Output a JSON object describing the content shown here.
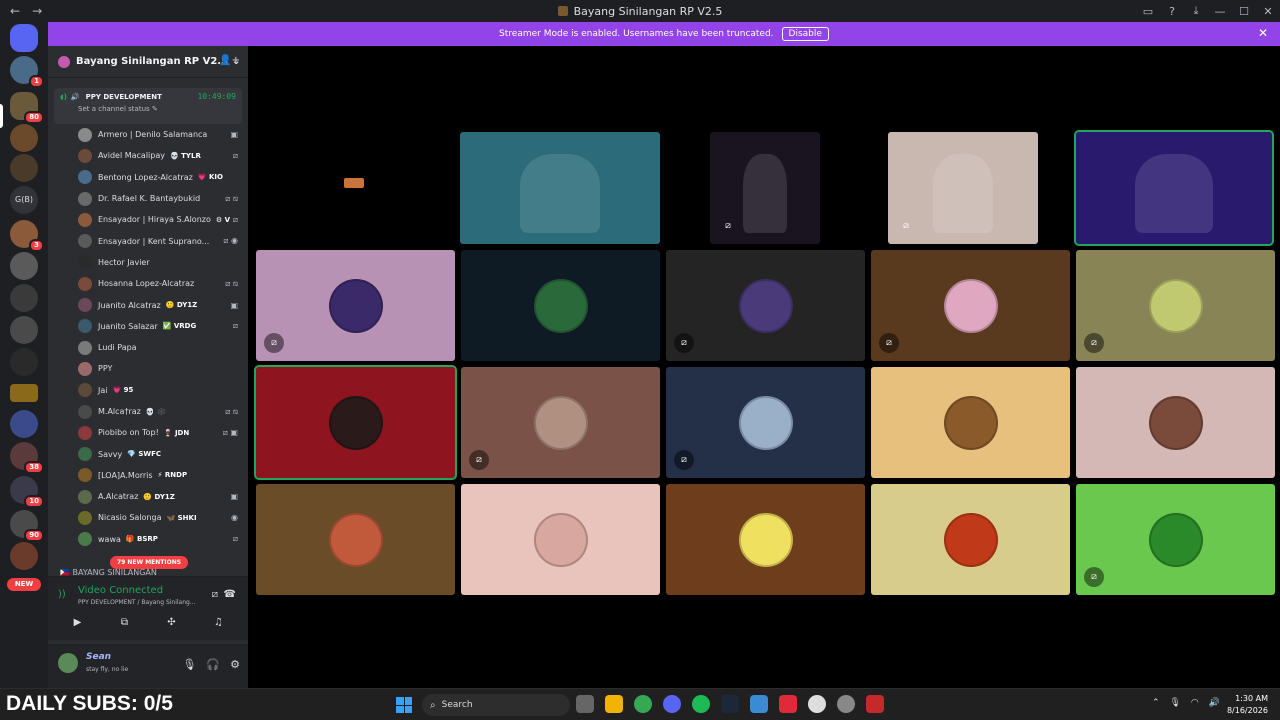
{
  "window": {
    "title": "Bayang Sinilangan RP V2.5",
    "back": "←",
    "forward": "→"
  },
  "banner": {
    "text": "Streamer Mode is enabled. Usernames have been truncated.",
    "button": "Disable",
    "close": "✕"
  },
  "servers": {
    "home_icon": "discord-icon",
    "badges": [
      "1",
      "80",
      "3",
      "38",
      "10",
      "90"
    ],
    "guild_initials": "G(B)",
    "new_label": "NEW"
  },
  "guild": {
    "name": "Bayang Sinilangan RP V2.5",
    "chevron": "⌄",
    "invite": "👤+"
  },
  "voice_channel": {
    "name": "PPY DEVELOPMENT",
    "time": "10:49:09",
    "status": "Set a channel status ✎"
  },
  "members": [
    {
      "name": "Armero | Denilo Salamanca",
      "tag": "",
      "icon": "▣"
    },
    {
      "name": "Avidel Macalipay",
      "tag": "💀 TYLR",
      "icon": "⧄"
    },
    {
      "name": "Bentong Lopez-Alcatraz",
      "tag": "💗 KIO",
      "icon": ""
    },
    {
      "name": "Dr. Rafael K. Bantaybukid",
      "tag": "",
      "icon": "⧄ ⧅"
    },
    {
      "name": "Ensayador | Hiraya S.Alonzo",
      "tag": "⚙ V",
      "icon": "⧄"
    },
    {
      "name": "Ensayador | Kent Suprano...",
      "tag": "",
      "icon": "⧄ ◉"
    },
    {
      "name": "Hector Javier",
      "tag": "",
      "icon": ""
    },
    {
      "name": "Hosanna Lopez-Alcatraz",
      "tag": "",
      "icon": "⧄ ⧅"
    },
    {
      "name": "Juanito Alcatraz",
      "tag": "🙂 DY1Z",
      "icon": "▣"
    },
    {
      "name": "Juanito Salazar",
      "tag": "✅ VRDG",
      "icon": "⧄"
    },
    {
      "name": "Ludi Papa",
      "tag": "",
      "icon": ""
    },
    {
      "name": "PPY",
      "tag": "",
      "icon": ""
    },
    {
      "name": "Jai",
      "tag": "💗 95",
      "icon": ""
    },
    {
      "name": "M.Alca†raz",
      "tag": "💀 🕸️",
      "icon": "⧄ ⧅"
    },
    {
      "name": "Piobibo on Top!",
      "tag": "🍷 JDN",
      "icon": "⧄ ▣"
    },
    {
      "name": "Savvy",
      "tag": "💎 SWFC",
      "icon": ""
    },
    {
      "name": "[LOA]A.Morris",
      "tag": "⚡ RNDP",
      "icon": ""
    },
    {
      "name": "A.Alcatraz",
      "tag": "🙂 DY1Z",
      "icon": "▣"
    },
    {
      "name": "Nicasio Salonga",
      "tag": "🦋 SHKI",
      "icon": "◉"
    },
    {
      "name": "wawa",
      "tag": "🎁 BSRP",
      "icon": "⧄"
    }
  ],
  "mentions": {
    "label": "79 NEW MENTIONS"
  },
  "next_channel": "BAYANG SINILANGAN",
  "voice_panel": {
    "status": "Video Connected",
    "sub": "PPY DEVELOPMENT / Bayang Sinilang...",
    "buttons": [
      "camera",
      "screen-share",
      "activities",
      "soundboard"
    ]
  },
  "user": {
    "name": "Sean",
    "status": "stay fly, no lie"
  },
  "overlay": {
    "text": "DAILY SUBS: 0/5"
  },
  "stage": {
    "top_row": [
      {
        "bg": "#000000",
        "kind": "logo"
      },
      {
        "bg": "#2b6b7a",
        "kind": "video"
      },
      {
        "bg": "#1a1420",
        "kind": "video",
        "mute": true
      },
      {
        "bg": "#c9b8b0",
        "kind": "video",
        "mute": true
      },
      {
        "bg": "#2a1a6e",
        "kind": "video",
        "selected": true
      }
    ],
    "grid": [
      {
        "bg": "#b892b4",
        "av": "#3a2a6a",
        "mute": true
      },
      {
        "bg": "#0e1a24",
        "av": "#2a6a3a"
      },
      {
        "bg": "#242424",
        "av": "#4a3a7a",
        "mute": true
      },
      {
        "bg": "#5a3a1e",
        "av": "#e0a8c0",
        "mute": true
      },
      {
        "bg": "#888455",
        "av": "#c0c870",
        "mute": true
      },
      {
        "bg": "#8e1420",
        "av": "#2a1a1a",
        "selected": true
      },
      {
        "bg": "#7a5248",
        "av": "#b09080",
        "mute": true
      },
      {
        "bg": "#243048",
        "av": "#9ab0c8",
        "mute": true
      },
      {
        "bg": "#e8c07e",
        "av": "#8a5a2a"
      },
      {
        "bg": "#d4b8b6",
        "av": "#7a4a3a"
      },
      {
        "bg": "#6a4c28",
        "av": "#c05a3a"
      },
      {
        "bg": "#e8c4bc",
        "av": "#d8a8a0"
      },
      {
        "bg": "#6e3e1c",
        "av": "#f0e060"
      },
      {
        "bg": "#d8cc8c",
        "av": "#c03a1a"
      },
      {
        "bg": "#6ac84e",
        "av": "#2a8a2a",
        "mute": true
      }
    ]
  },
  "taskbar": {
    "search": "Search",
    "time": "1:30 AM",
    "date": "8/16/2026"
  }
}
